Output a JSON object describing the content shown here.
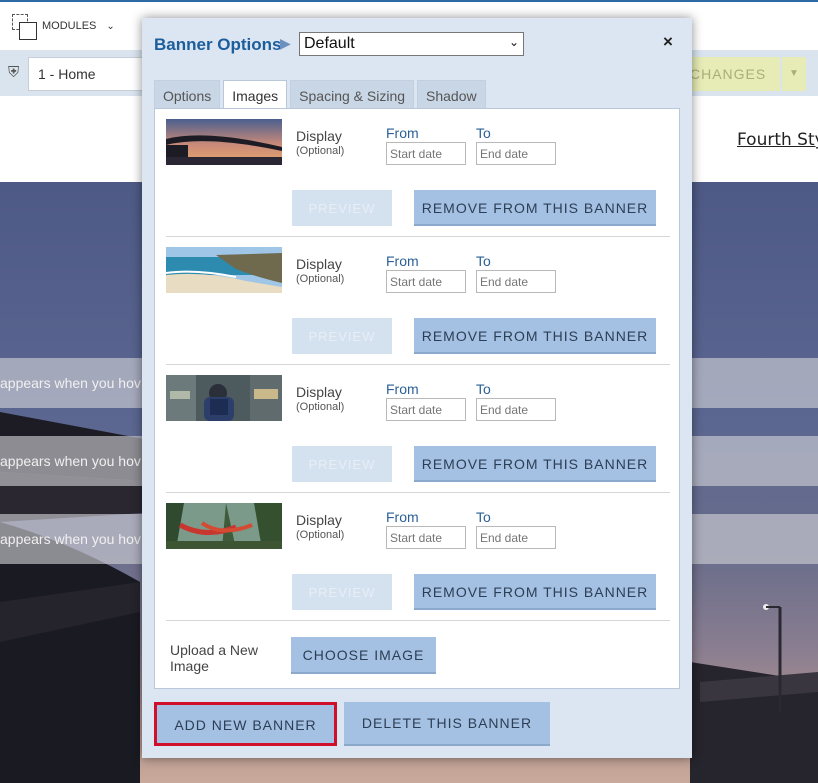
{
  "topbar": {
    "modules_label": "MODULES"
  },
  "toolbar": {
    "page_select_value": "1 - Home",
    "changes_label": "CHANGES"
  },
  "page": {
    "nav_item": "Fourth Sty",
    "band_text": "appears when you hov"
  },
  "dialog": {
    "title": "Banner Options",
    "banner_select_value": "Default",
    "close_label": "×",
    "tabs": [
      {
        "label": "Options",
        "active": false
      },
      {
        "label": "Images",
        "active": true
      },
      {
        "label": "Spacing & Sizing",
        "active": false
      },
      {
        "label": "Shadow",
        "active": false
      }
    ],
    "images": [
      {
        "thumb": "bridge-sunset",
        "display_label": "Display",
        "optional_label": "(Optional)",
        "from_label": "From",
        "to_label": "To",
        "start_placeholder": "Start date",
        "end_placeholder": "End date",
        "preview_label": "PREVIEW",
        "remove_label": "REMOVE FROM THIS BANNER"
      },
      {
        "thumb": "beach",
        "display_label": "Display",
        "optional_label": "(Optional)",
        "from_label": "From",
        "to_label": "To",
        "start_placeholder": "Start date",
        "end_placeholder": "End date",
        "preview_label": "PREVIEW",
        "remove_label": "REMOVE FROM THIS BANNER"
      },
      {
        "thumb": "traveler-street",
        "display_label": "Display",
        "optional_label": "(Optional)",
        "from_label": "From",
        "to_label": "To",
        "start_placeholder": "Start date",
        "end_placeholder": "End date",
        "preview_label": "PREVIEW",
        "remove_label": "REMOVE FROM THIS BANNER"
      },
      {
        "thumb": "hammock-forest",
        "display_label": "Display",
        "optional_label": "(Optional)",
        "from_label": "From",
        "to_label": "To",
        "start_placeholder": "Start date",
        "end_placeholder": "End date",
        "preview_label": "PREVIEW",
        "remove_label": "REMOVE FROM THIS BANNER"
      }
    ],
    "upload_label": "Upload a New Image",
    "choose_image_label": "CHOOSE IMAGE",
    "add_banner_label": "ADD NEW BANNER",
    "delete_banner_label": "DELETE THIS BANNER"
  },
  "colors": {
    "title_blue": "#1c5d9c",
    "button_blue": "#a4c1e3",
    "highlight_red": "#d0102a",
    "dialog_bg": "#dce6f2"
  }
}
